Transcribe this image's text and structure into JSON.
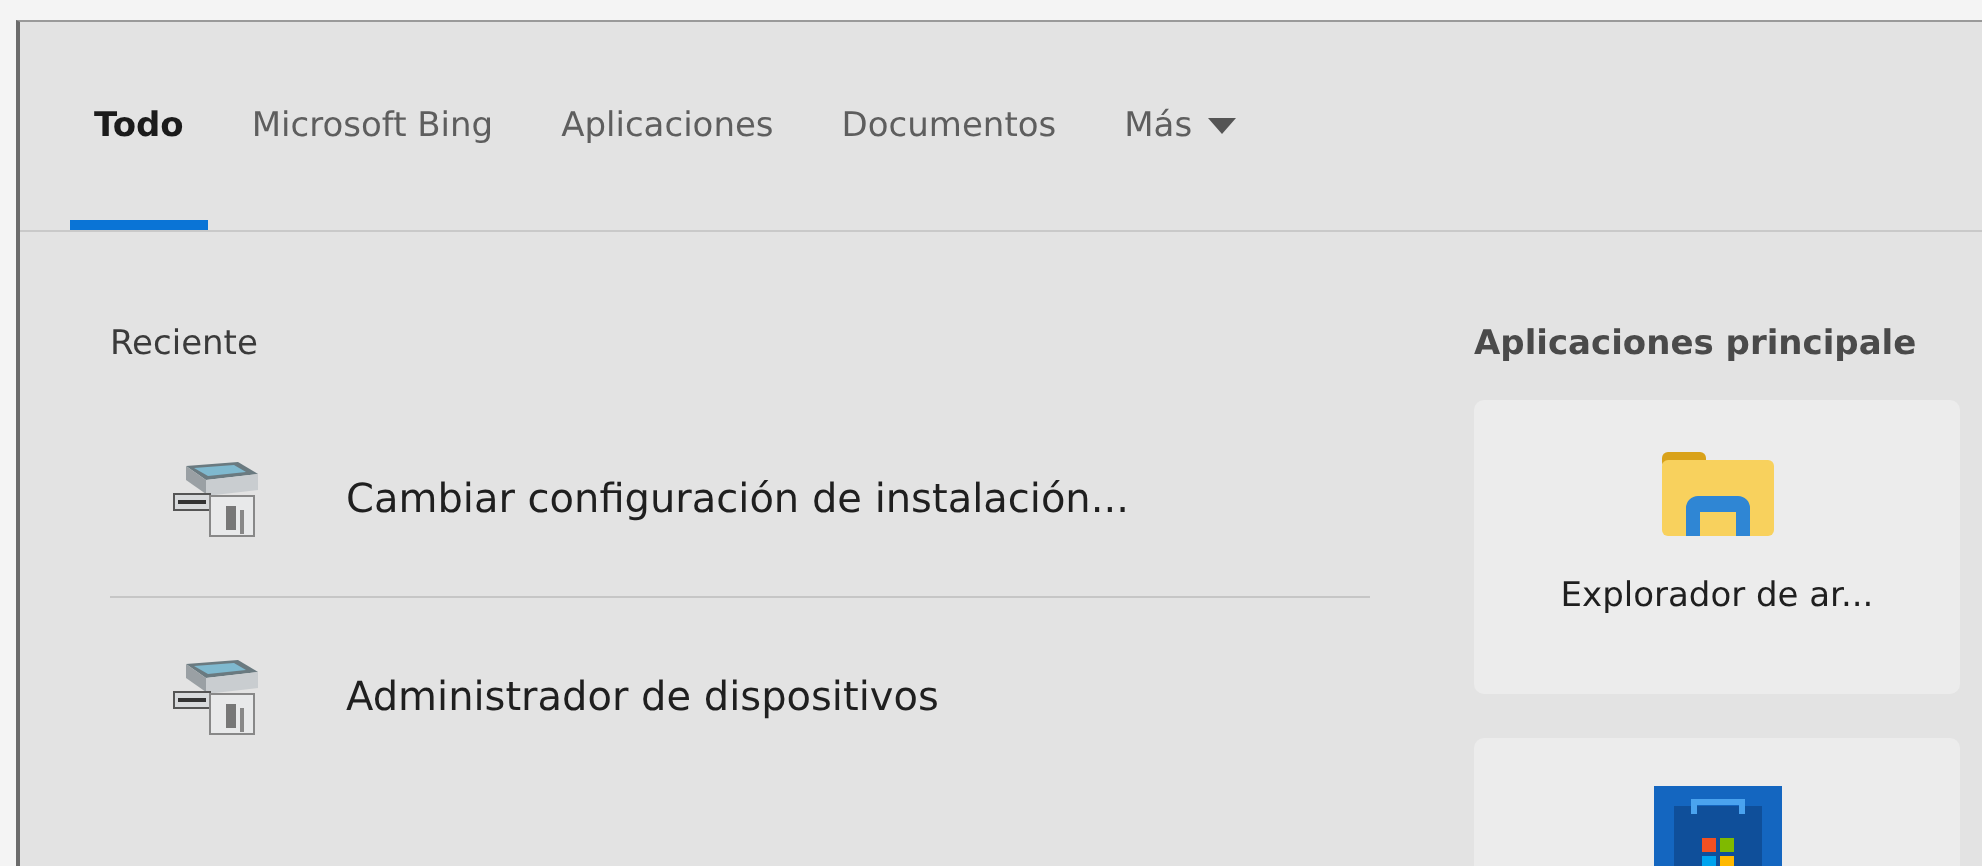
{
  "tabs": [
    {
      "label": "Todo",
      "selected": true,
      "dropdown": false
    },
    {
      "label": "Microsoft Bing",
      "selected": false,
      "dropdown": false
    },
    {
      "label": "Aplicaciones",
      "selected": false,
      "dropdown": false
    },
    {
      "label": "Documentos",
      "selected": false,
      "dropdown": false
    },
    {
      "label": "Más",
      "selected": false,
      "dropdown": true
    }
  ],
  "recent": {
    "heading": "Reciente",
    "items": [
      {
        "label": "Cambiar configuración de instalación..."
      },
      {
        "label": "Administrador de dispositivos"
      }
    ]
  },
  "top_apps": {
    "heading": "Aplicaciones principale",
    "items": [
      {
        "kind": "folder",
        "label": "Explorador de ar..."
      },
      {
        "kind": "store"
      }
    ]
  }
}
